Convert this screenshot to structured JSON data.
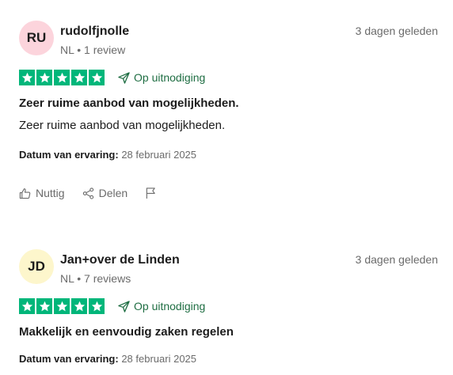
{
  "colors": {
    "star_green": "#00b67a",
    "invite_green": "#1f6e43",
    "muted_text": "#6b6b6b"
  },
  "reviews": [
    {
      "initials": "RU",
      "avatar_color": "#fcd4dc",
      "author": "rudolfjnolle",
      "meta": "NL • 1 review",
      "date": "3 dagen geleden",
      "rating": 5,
      "invite_label": "Op uitnodiging",
      "title": "Zeer ruime aanbod van mogelijkheden.",
      "body": "Zeer ruime aanbod van mogelijkheden.",
      "experience_label": "Datum van ervaring:",
      "experience_date": "28 februari 2025",
      "actions": {
        "useful": "Nuttig",
        "share": "Delen"
      }
    },
    {
      "initials": "JD",
      "avatar_color": "#fdf6cc",
      "author": "Jan+over de Linden",
      "meta": "NL • 7 reviews",
      "date": "3 dagen geleden",
      "rating": 5,
      "invite_label": "Op uitnodiging",
      "title": "Makkelijk en eenvoudig zaken regelen",
      "experience_label": "Datum van ervaring:",
      "experience_date": "28 februari 2025"
    }
  ]
}
